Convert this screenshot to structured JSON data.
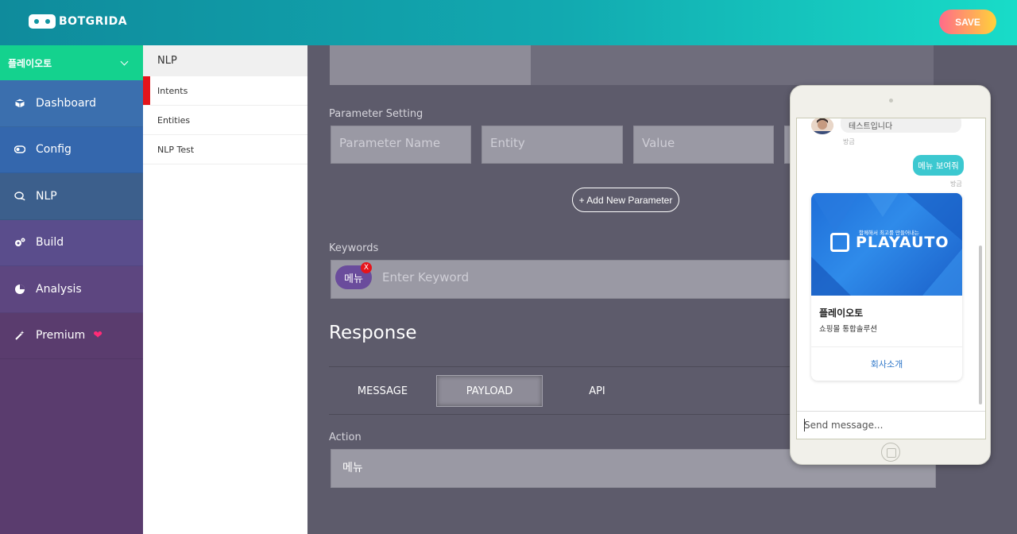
{
  "header": {
    "logo_text": "BOTGRIDA",
    "save_label": "SAVE"
  },
  "sidebar": {
    "project": "플레이오토",
    "items": [
      {
        "label": "Dashboard",
        "icon": "cube-icon"
      },
      {
        "label": "Config",
        "icon": "toggle-icon"
      },
      {
        "label": "NLP",
        "icon": "chat-icon"
      },
      {
        "label": "Build",
        "icon": "gears-icon"
      },
      {
        "label": "Analysis",
        "icon": "pie-chart-icon"
      },
      {
        "label": "Premium",
        "icon": "magic-wand-icon"
      }
    ]
  },
  "submenu": {
    "title": "NLP",
    "items": [
      {
        "label": "Intents"
      },
      {
        "label": "Entities"
      },
      {
        "label": "NLP Test"
      }
    ]
  },
  "main": {
    "parameter_setting_label": "Parameter Setting",
    "param_placeholders": {
      "name": "Parameter Name",
      "entity": "Entity",
      "value": "Value"
    },
    "add_parameter_label": "+ Add New Parameter",
    "keywords_label": "Keywords",
    "keyword_chip": "메뉴",
    "keyword_chip_remove": "X",
    "keyword_placeholder": "Enter Keyword",
    "response_title": "Response",
    "tabs": [
      {
        "label": "MESSAGE"
      },
      {
        "label": "PAYLOAD"
      },
      {
        "label": "API"
      }
    ],
    "active_tab": "PAYLOAD",
    "action_label": "Action",
    "action_value": "메뉴"
  },
  "preview": {
    "bot_message": "테스트입니다",
    "bot_time": "방금",
    "user_message": "메뉴 보여줘",
    "user_time": "방금",
    "card": {
      "image_tagline": "함께해서 최고를 만들어내는",
      "image_brand": "PLAYAUTO",
      "title": "플레이오토",
      "subtitle": "쇼핑몰 통합솔루션",
      "link_label": "회사소개"
    },
    "input_placeholder": "Send message..."
  },
  "colors": {
    "header_start": "#0f8b9c",
    "header_end": "#18dcc8",
    "project_bar": "#14d28e",
    "active_indicator": "#e4141b",
    "user_bubble": "#3cc8d0"
  }
}
